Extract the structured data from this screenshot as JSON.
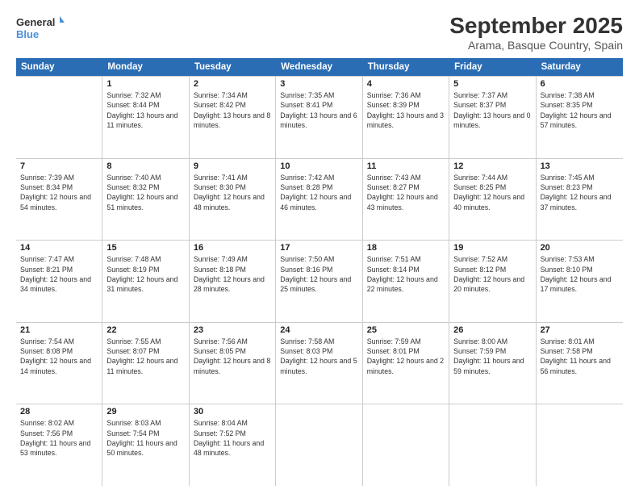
{
  "header": {
    "logo_line1": "General",
    "logo_line2": "Blue",
    "month_title": "September 2025",
    "location": "Arama, Basque Country, Spain"
  },
  "weekdays": [
    "Sunday",
    "Monday",
    "Tuesday",
    "Wednesday",
    "Thursday",
    "Friday",
    "Saturday"
  ],
  "weeks": [
    [
      {
        "day": "",
        "sunrise": "",
        "sunset": "",
        "daylight": ""
      },
      {
        "day": "1",
        "sunrise": "Sunrise: 7:32 AM",
        "sunset": "Sunset: 8:44 PM",
        "daylight": "Daylight: 13 hours and 11 minutes."
      },
      {
        "day": "2",
        "sunrise": "Sunrise: 7:34 AM",
        "sunset": "Sunset: 8:42 PM",
        "daylight": "Daylight: 13 hours and 8 minutes."
      },
      {
        "day": "3",
        "sunrise": "Sunrise: 7:35 AM",
        "sunset": "Sunset: 8:41 PM",
        "daylight": "Daylight: 13 hours and 6 minutes."
      },
      {
        "day": "4",
        "sunrise": "Sunrise: 7:36 AM",
        "sunset": "Sunset: 8:39 PM",
        "daylight": "Daylight: 13 hours and 3 minutes."
      },
      {
        "day": "5",
        "sunrise": "Sunrise: 7:37 AM",
        "sunset": "Sunset: 8:37 PM",
        "daylight": "Daylight: 13 hours and 0 minutes."
      },
      {
        "day": "6",
        "sunrise": "Sunrise: 7:38 AM",
        "sunset": "Sunset: 8:35 PM",
        "daylight": "Daylight: 12 hours and 57 minutes."
      }
    ],
    [
      {
        "day": "7",
        "sunrise": "Sunrise: 7:39 AM",
        "sunset": "Sunset: 8:34 PM",
        "daylight": "Daylight: 12 hours and 54 minutes."
      },
      {
        "day": "8",
        "sunrise": "Sunrise: 7:40 AM",
        "sunset": "Sunset: 8:32 PM",
        "daylight": "Daylight: 12 hours and 51 minutes."
      },
      {
        "day": "9",
        "sunrise": "Sunrise: 7:41 AM",
        "sunset": "Sunset: 8:30 PM",
        "daylight": "Daylight: 12 hours and 48 minutes."
      },
      {
        "day": "10",
        "sunrise": "Sunrise: 7:42 AM",
        "sunset": "Sunset: 8:28 PM",
        "daylight": "Daylight: 12 hours and 46 minutes."
      },
      {
        "day": "11",
        "sunrise": "Sunrise: 7:43 AM",
        "sunset": "Sunset: 8:27 PM",
        "daylight": "Daylight: 12 hours and 43 minutes."
      },
      {
        "day": "12",
        "sunrise": "Sunrise: 7:44 AM",
        "sunset": "Sunset: 8:25 PM",
        "daylight": "Daylight: 12 hours and 40 minutes."
      },
      {
        "day": "13",
        "sunrise": "Sunrise: 7:45 AM",
        "sunset": "Sunset: 8:23 PM",
        "daylight": "Daylight: 12 hours and 37 minutes."
      }
    ],
    [
      {
        "day": "14",
        "sunrise": "Sunrise: 7:47 AM",
        "sunset": "Sunset: 8:21 PM",
        "daylight": "Daylight: 12 hours and 34 minutes."
      },
      {
        "day": "15",
        "sunrise": "Sunrise: 7:48 AM",
        "sunset": "Sunset: 8:19 PM",
        "daylight": "Daylight: 12 hours and 31 minutes."
      },
      {
        "day": "16",
        "sunrise": "Sunrise: 7:49 AM",
        "sunset": "Sunset: 8:18 PM",
        "daylight": "Daylight: 12 hours and 28 minutes."
      },
      {
        "day": "17",
        "sunrise": "Sunrise: 7:50 AM",
        "sunset": "Sunset: 8:16 PM",
        "daylight": "Daylight: 12 hours and 25 minutes."
      },
      {
        "day": "18",
        "sunrise": "Sunrise: 7:51 AM",
        "sunset": "Sunset: 8:14 PM",
        "daylight": "Daylight: 12 hours and 22 minutes."
      },
      {
        "day": "19",
        "sunrise": "Sunrise: 7:52 AM",
        "sunset": "Sunset: 8:12 PM",
        "daylight": "Daylight: 12 hours and 20 minutes."
      },
      {
        "day": "20",
        "sunrise": "Sunrise: 7:53 AM",
        "sunset": "Sunset: 8:10 PM",
        "daylight": "Daylight: 12 hours and 17 minutes."
      }
    ],
    [
      {
        "day": "21",
        "sunrise": "Sunrise: 7:54 AM",
        "sunset": "Sunset: 8:08 PM",
        "daylight": "Daylight: 12 hours and 14 minutes."
      },
      {
        "day": "22",
        "sunrise": "Sunrise: 7:55 AM",
        "sunset": "Sunset: 8:07 PM",
        "daylight": "Daylight: 12 hours and 11 minutes."
      },
      {
        "day": "23",
        "sunrise": "Sunrise: 7:56 AM",
        "sunset": "Sunset: 8:05 PM",
        "daylight": "Daylight: 12 hours and 8 minutes."
      },
      {
        "day": "24",
        "sunrise": "Sunrise: 7:58 AM",
        "sunset": "Sunset: 8:03 PM",
        "daylight": "Daylight: 12 hours and 5 minutes."
      },
      {
        "day": "25",
        "sunrise": "Sunrise: 7:59 AM",
        "sunset": "Sunset: 8:01 PM",
        "daylight": "Daylight: 12 hours and 2 minutes."
      },
      {
        "day": "26",
        "sunrise": "Sunrise: 8:00 AM",
        "sunset": "Sunset: 7:59 PM",
        "daylight": "Daylight: 11 hours and 59 minutes."
      },
      {
        "day": "27",
        "sunrise": "Sunrise: 8:01 AM",
        "sunset": "Sunset: 7:58 PM",
        "daylight": "Daylight: 11 hours and 56 minutes."
      }
    ],
    [
      {
        "day": "28",
        "sunrise": "Sunrise: 8:02 AM",
        "sunset": "Sunset: 7:56 PM",
        "daylight": "Daylight: 11 hours and 53 minutes."
      },
      {
        "day": "29",
        "sunrise": "Sunrise: 8:03 AM",
        "sunset": "Sunset: 7:54 PM",
        "daylight": "Daylight: 11 hours and 50 minutes."
      },
      {
        "day": "30",
        "sunrise": "Sunrise: 8:04 AM",
        "sunset": "Sunset: 7:52 PM",
        "daylight": "Daylight: 11 hours and 48 minutes."
      },
      {
        "day": "",
        "sunrise": "",
        "sunset": "",
        "daylight": ""
      },
      {
        "day": "",
        "sunrise": "",
        "sunset": "",
        "daylight": ""
      },
      {
        "day": "",
        "sunrise": "",
        "sunset": "",
        "daylight": ""
      },
      {
        "day": "",
        "sunrise": "",
        "sunset": "",
        "daylight": ""
      }
    ]
  ]
}
